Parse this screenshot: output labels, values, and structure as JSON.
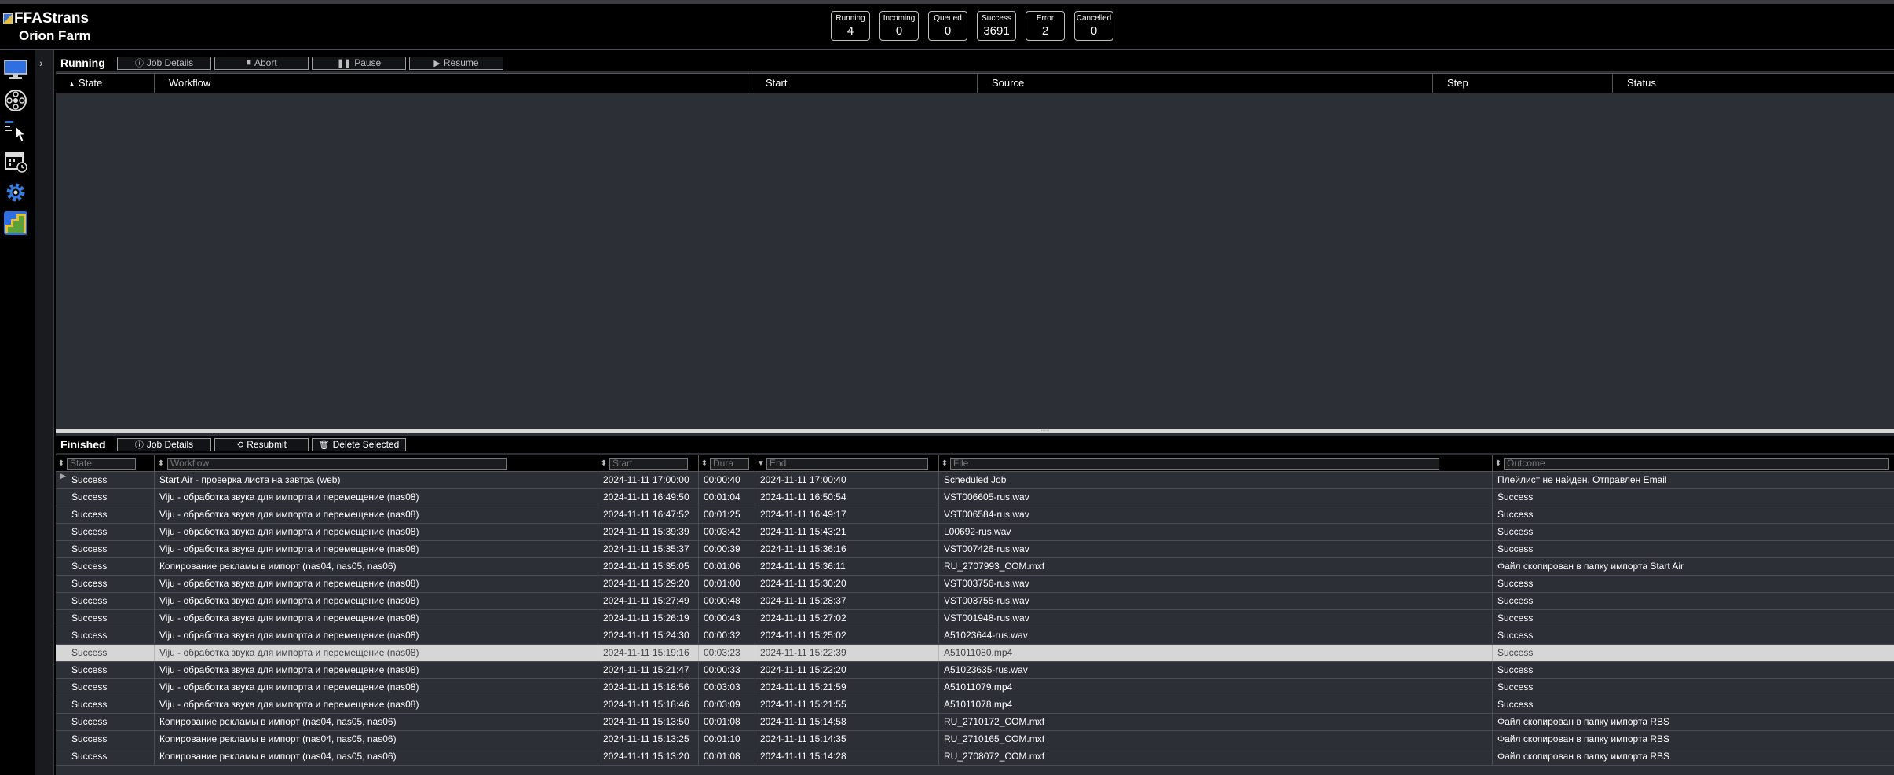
{
  "app": {
    "name": "FFAStrans",
    "farm_name": "Orion Farm"
  },
  "counters": [
    {
      "label": "Running",
      "value": "4"
    },
    {
      "label": "Incoming",
      "value": "0"
    },
    {
      "label": "Queued",
      "value": "0"
    },
    {
      "label": "Success",
      "value": "3691"
    },
    {
      "label": "Error",
      "value": "2"
    },
    {
      "label": "Cancelled",
      "value": "0"
    }
  ],
  "sidebar_icons": [
    "monitor-icon",
    "film-reel-icon",
    "click-workflow-icon",
    "calendar-clock-icon",
    "settings-gear-icon",
    "ffastrans-logo-icon"
  ],
  "running": {
    "title": "Running",
    "buttons": {
      "job_details": "Job Details",
      "abort": "Abort",
      "pause": "Pause",
      "resume": "Resume"
    },
    "columns": {
      "state": "State",
      "workflow": "Workflow",
      "start": "Start",
      "source": "Source",
      "step": "Step",
      "status": "Status"
    }
  },
  "finished": {
    "title": "Finished",
    "buttons": {
      "job_details": "Job Details",
      "resubmit": "Resubmit",
      "delete_selected": "Delete Selected"
    },
    "filters": {
      "state": "State",
      "workflow": "Workflow",
      "start": "Start",
      "duration": "Dura",
      "end": "End",
      "file": "File",
      "outcome": "Outcome"
    },
    "rows": [
      {
        "state": "Success",
        "workflow": "Start Air - проверка листа на завтра (web)",
        "start": "2024-11-11 17:00:00",
        "duration": "00:00:40",
        "end": "2024-11-11 17:00:40",
        "file": "Scheduled Job",
        "outcome": "Плейлист не найден. Отправлен Email"
      },
      {
        "state": "Success",
        "workflow": "Viju - обработка звука для импорта и перемещение (nas08)",
        "start": "2024-11-11 16:49:50",
        "duration": "00:01:04",
        "end": "2024-11-11 16:50:54",
        "file": "VST006605-rus.wav",
        "outcome": "Success"
      },
      {
        "state": "Success",
        "workflow": "Viju - обработка звука для импорта и перемещение (nas08)",
        "start": "2024-11-11 16:47:52",
        "duration": "00:01:25",
        "end": "2024-11-11 16:49:17",
        "file": "VST006584-rus.wav",
        "outcome": "Success"
      },
      {
        "state": "Success",
        "workflow": "Viju - обработка звука для импорта и перемещение (nas08)",
        "start": "2024-11-11 15:39:39",
        "duration": "00:03:42",
        "end": "2024-11-11 15:43:21",
        "file": "L00692-rus.wav",
        "outcome": "Success"
      },
      {
        "state": "Success",
        "workflow": "Viju - обработка звука для импорта и перемещение (nas08)",
        "start": "2024-11-11 15:35:37",
        "duration": "00:00:39",
        "end": "2024-11-11 15:36:16",
        "file": "VST007426-rus.wav",
        "outcome": "Success"
      },
      {
        "state": "Success",
        "workflow": "Копирование рекламы в импорт (nas04, nas05, nas06)",
        "start": "2024-11-11 15:35:05",
        "duration": "00:01:06",
        "end": "2024-11-11 15:36:11",
        "file": "RU_2707993_COM.mxf",
        "outcome": "Файл скопирован в папку импорта Start Air"
      },
      {
        "state": "Success",
        "workflow": "Viju - обработка звука для импорта и перемещение (nas08)",
        "start": "2024-11-11 15:29:20",
        "duration": "00:01:00",
        "end": "2024-11-11 15:30:20",
        "file": "VST003756-rus.wav",
        "outcome": "Success"
      },
      {
        "state": "Success",
        "workflow": "Viju - обработка звука для импорта и перемещение (nas08)",
        "start": "2024-11-11 15:27:49",
        "duration": "00:00:48",
        "end": "2024-11-11 15:28:37",
        "file": "VST003755-rus.wav",
        "outcome": "Success"
      },
      {
        "state": "Success",
        "workflow": "Viju - обработка звука для импорта и перемещение (nas08)",
        "start": "2024-11-11 15:26:19",
        "duration": "00:00:43",
        "end": "2024-11-11 15:27:02",
        "file": "VST001948-rus.wav",
        "outcome": "Success"
      },
      {
        "state": "Success",
        "workflow": "Viju - обработка звука для импорта и перемещение (nas08)",
        "start": "2024-11-11 15:24:30",
        "duration": "00:00:32",
        "end": "2024-11-11 15:25:02",
        "file": "A51023644-rus.wav",
        "outcome": "Success"
      },
      {
        "state": "Success",
        "workflow": "Viju - обработка звука для импорта и перемещение (nas08)",
        "start": "2024-11-11 15:19:16",
        "duration": "00:03:23",
        "end": "2024-11-11 15:22:39",
        "file": "A51011080.mp4",
        "outcome": "Success"
      },
      {
        "state": "Success",
        "workflow": "Viju - обработка звука для импорта и перемещение (nas08)",
        "start": "2024-11-11 15:21:47",
        "duration": "00:00:33",
        "end": "2024-11-11 15:22:20",
        "file": "A51023635-rus.wav",
        "outcome": "Success"
      },
      {
        "state": "Success",
        "workflow": "Viju - обработка звука для импорта и перемещение (nas08)",
        "start": "2024-11-11 15:18:56",
        "duration": "00:03:03",
        "end": "2024-11-11 15:21:59",
        "file": "A51011079.mp4",
        "outcome": "Success"
      },
      {
        "state": "Success",
        "workflow": "Viju - обработка звука для импорта и перемещение (nas08)",
        "start": "2024-11-11 15:18:46",
        "duration": "00:03:09",
        "end": "2024-11-11 15:21:55",
        "file": "A51011078.mp4",
        "outcome": "Success"
      },
      {
        "state": "Success",
        "workflow": "Копирование рекламы в импорт (nas04, nas05, nas06)",
        "start": "2024-11-11 15:13:50",
        "duration": "00:01:08",
        "end": "2024-11-11 15:14:58",
        "file": "RU_2710172_COM.mxf",
        "outcome": "Файл скопирован в папку импорта RBS"
      },
      {
        "state": "Success",
        "workflow": "Копирование рекламы в импорт (nas04, nas05, nas06)",
        "start": "2024-11-11 15:13:25",
        "duration": "00:01:10",
        "end": "2024-11-11 15:14:35",
        "file": "RU_2710165_COM.mxf",
        "outcome": "Файл скопирован в папку импорта RBS"
      },
      {
        "state": "Success",
        "workflow": "Копирование рекламы в импорт (nas04, nas05, nas06)",
        "start": "2024-11-11 15:13:20",
        "duration": "00:01:08",
        "end": "2024-11-11 15:14:28",
        "file": "RU_2708072_COM.mxf",
        "outcome": "Файл скопирован в папку импорта RBS"
      }
    ]
  }
}
